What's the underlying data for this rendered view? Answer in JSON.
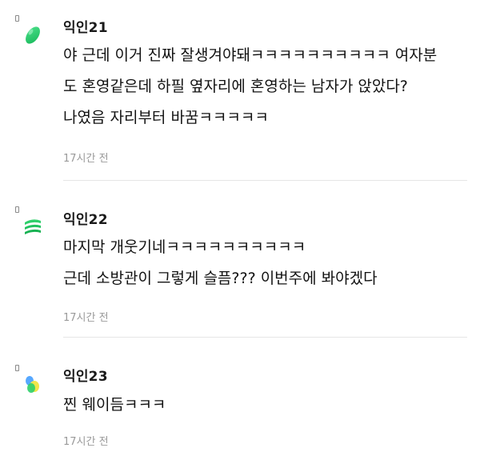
{
  "comments": [
    {
      "name": "익인21",
      "avatar": "green-oval-icon",
      "lines": [
        "야 근데 이거 진짜 잘생겨야돼ㅋㅋㅋㅋㅋㅋㅋㅋㅋㅋ 여자분",
        "도 혼영같은데 하필 옆자리에 혼영하는 남자가 앉았다?",
        "나였음 자리부터 바꿈ㅋㅋㅋㅋㅋ"
      ],
      "time": "17시간 전"
    },
    {
      "name": "익인22",
      "avatar": "green-stacked-lines-icon",
      "lines": [
        "마지막 개웃기네ㅋㅋㅋㅋㅋㅋㅋㅋㅋㅋ",
        "근데 소방관이 그렇게 슬픔??? 이번주에 봐야겠다"
      ],
      "time": "17시간 전"
    },
    {
      "name": "익인23",
      "avatar": "blue-yellow-green-blob-icon",
      "lines": [
        "찐 웨이듬ㅋㅋㅋ"
      ],
      "time": "17시간 전"
    }
  ],
  "colors": {
    "text": "#121212",
    "meta": "#9a9a9a",
    "divider": "#e6e6e6",
    "avatar_green": "#2ecf6a",
    "avatar_blue": "#56a8ff",
    "avatar_yellow": "#f2e64a"
  }
}
